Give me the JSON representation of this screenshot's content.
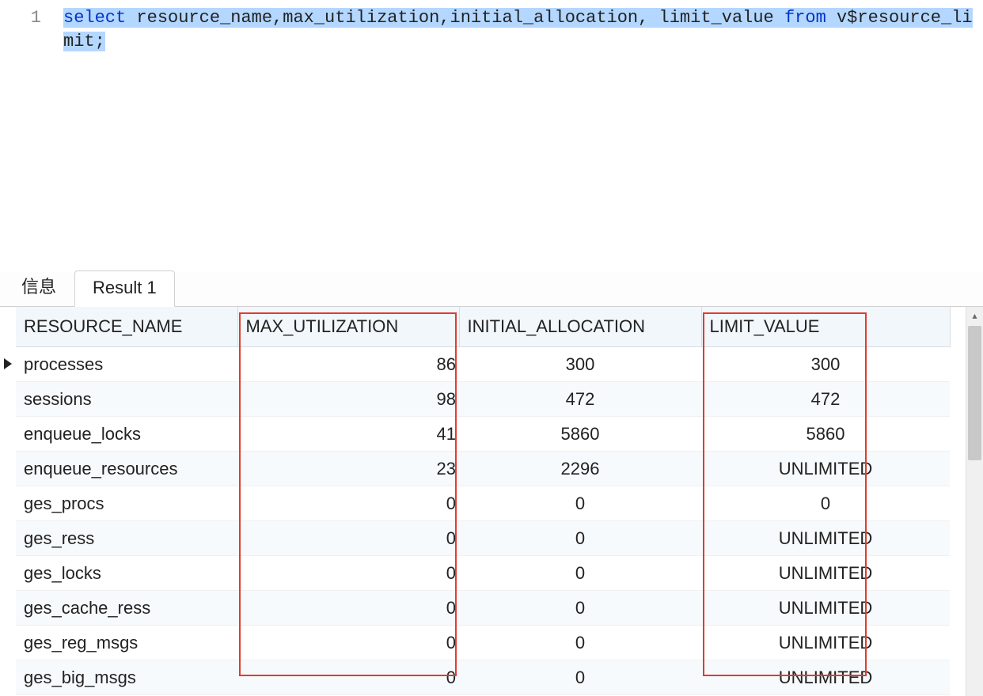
{
  "editor": {
    "line_number": "1",
    "sql_kw_select": "select",
    "sql_fields": " resource_name,max_utilization,initial_allocation, limit_value ",
    "sql_kw_from": "from",
    "sql_rest": " v$resource_limit;"
  },
  "tabs": {
    "info_label": "信息",
    "result1_label": "Result 1"
  },
  "columns": {
    "resource_name": "RESOURCE_NAME",
    "max_utilization": "MAX_UTILIZATION",
    "initial_allocation": "INITIAL_ALLOCATION",
    "limit_value": "LIMIT_VALUE"
  },
  "rows": [
    {
      "resource_name": "processes",
      "max_utilization": "86",
      "initial_allocation": "300",
      "limit_value": "300"
    },
    {
      "resource_name": "sessions",
      "max_utilization": "98",
      "initial_allocation": "472",
      "limit_value": "472"
    },
    {
      "resource_name": "enqueue_locks",
      "max_utilization": "41",
      "initial_allocation": "5860",
      "limit_value": "5860"
    },
    {
      "resource_name": "enqueue_resources",
      "max_utilization": "23",
      "initial_allocation": "2296",
      "limit_value": "UNLIMITED"
    },
    {
      "resource_name": "ges_procs",
      "max_utilization": "0",
      "initial_allocation": "0",
      "limit_value": "0"
    },
    {
      "resource_name": "ges_ress",
      "max_utilization": "0",
      "initial_allocation": "0",
      "limit_value": "UNLIMITED"
    },
    {
      "resource_name": "ges_locks",
      "max_utilization": "0",
      "initial_allocation": "0",
      "limit_value": "UNLIMITED"
    },
    {
      "resource_name": "ges_cache_ress",
      "max_utilization": "0",
      "initial_allocation": "0",
      "limit_value": "UNLIMITED"
    },
    {
      "resource_name": "ges_reg_msgs",
      "max_utilization": "0",
      "initial_allocation": "0",
      "limit_value": "UNLIMITED"
    },
    {
      "resource_name": "ges_big_msgs",
      "max_utilization": "0",
      "initial_allocation": "0",
      "limit_value": "UNLIMITED"
    }
  ],
  "highlight": {
    "col_max_box": true,
    "col_limit_box": true
  }
}
